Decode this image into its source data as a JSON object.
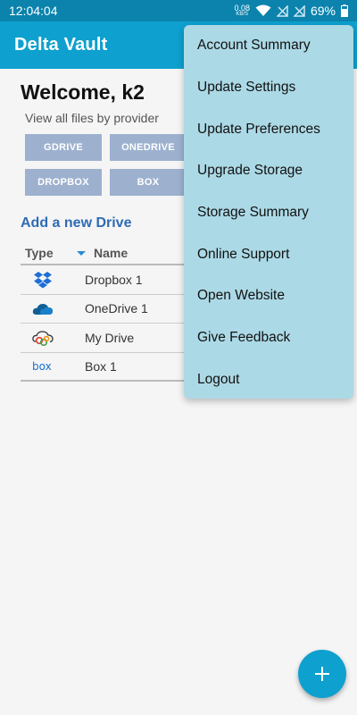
{
  "status_bar": {
    "time": "12:04:04",
    "net_speed": "0.08",
    "net_unit": "KB/S",
    "battery": "69%"
  },
  "appbar": {
    "title": "Delta Vault"
  },
  "main": {
    "welcome": "Welcome, k2",
    "subtitle": "View all files by provider",
    "providers": [
      "GDRIVE",
      "ONEDRIVE",
      "DROPBOX",
      "BOX"
    ],
    "add_drive": "Add a new Drive",
    "table": {
      "headers": {
        "type": "Type",
        "name": "Name"
      },
      "rows": [
        {
          "name": "Dropbox 1",
          "icon": "dropbox-icon"
        },
        {
          "name": "OneDrive 1",
          "icon": "onedrive-icon"
        },
        {
          "name": "My Drive",
          "icon": "mydrive-icon"
        },
        {
          "name": "Box 1",
          "icon": "box-icon"
        }
      ]
    }
  },
  "menu": {
    "items": [
      "Account Summary",
      "Update Settings",
      "Update Preferences",
      "Upgrade Storage",
      "Storage Summary",
      "Online Support",
      "Open Website",
      "Give Feedback",
      "Logout"
    ]
  },
  "colors": {
    "status_bar": "#0b83ad",
    "appbar": "#0ea0cf",
    "menu_bg": "#acd9e6",
    "provider_button": "#9db1cf",
    "link": "#2e6bb4"
  }
}
